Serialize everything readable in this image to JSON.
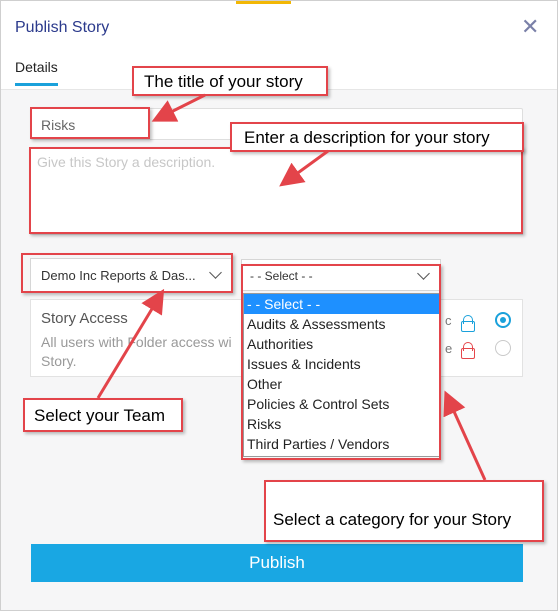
{
  "dialog": {
    "title": "Publish Story",
    "close_icon": "close-icon"
  },
  "tabs": [
    {
      "label": "Details"
    }
  ],
  "form": {
    "title_value": "Risks",
    "description_placeholder": "Give this Story a description.",
    "team_select_value": "Demo Inc Reports & Das...",
    "category_select_value": "- - Select - -",
    "category_options": [
      "- - Select - -",
      "Audits & Assessments",
      "Authorities",
      "Issues & Incidents",
      "Other",
      "Policies & Control Sets",
      "Risks",
      "Third Parties / Vendors"
    ],
    "selected_option_index": 0
  },
  "access": {
    "title": "Story Access",
    "description": "All users with Folder access wi Story.",
    "public_label": "c",
    "private_label": "e",
    "selected": "public"
  },
  "publish_label": "Publish",
  "annotations": {
    "title_note": "The title of your story",
    "description_note": "Enter a description for your story",
    "team_note": "Select your Team",
    "category_note": "Select a category for your Story"
  },
  "colors": {
    "accent": "#19a7e3",
    "annotation_red": "#e3444a",
    "title_text": "#2b3a8c",
    "dropdown_selected": "#1e90ff"
  }
}
